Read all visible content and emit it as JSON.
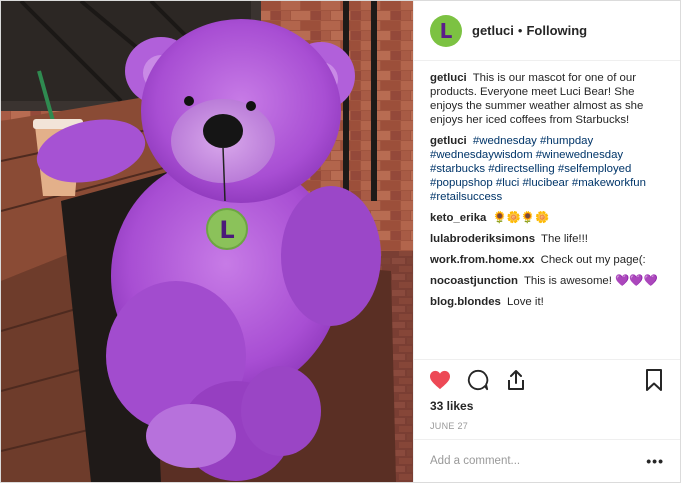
{
  "header": {
    "avatar_letter": "L",
    "username": "getluci",
    "separator": "•",
    "follow_status": "Following"
  },
  "caption": {
    "username": "getluci",
    "text": "This is our mascot for one of our products. Everyone meet Luci Bear! She enjoys the summer weather almost as she enjoys her iced coffees from Starbucks!"
  },
  "hashtag_comment": {
    "username": "getluci",
    "tags": "#wednesday #humpday #wednesdaywisdom #winewednesday #starbucks #directselling #selfemployed #popupshop #luci #lucibear #makeworkfun #retailsuccess"
  },
  "comments": [
    {
      "username": "keto_erika",
      "text": "🌻🌼🌻🌼"
    },
    {
      "username": "lulabroderiksimons",
      "text": "The life!!!"
    },
    {
      "username": "work.from.home.xx",
      "text": "Check out my page(:"
    },
    {
      "username": "nocoastjunction",
      "text": "This is awesome! 💜💜💜"
    },
    {
      "username": "blog.blondes",
      "text": "Love it!"
    }
  ],
  "likes": "33 likes",
  "date": "JUNE 27",
  "comment_input": {
    "placeholder": "Add a comment..."
  },
  "more_label": "•••",
  "pendant_letter": "L",
  "colors": {
    "accent_like": "#ed4956",
    "brand_green": "#7cc242",
    "bear_purple": "#b45ad8"
  },
  "icons": [
    "heart-icon",
    "comment-icon",
    "share-icon",
    "bookmark-icon"
  ]
}
